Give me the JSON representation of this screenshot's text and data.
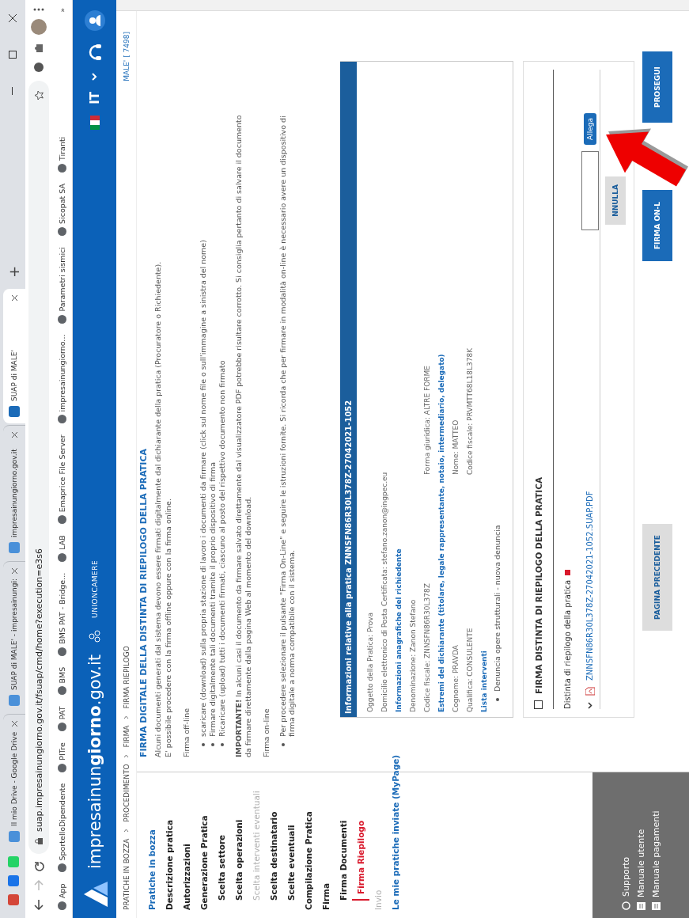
{
  "browser": {
    "tabs": [
      {
        "title": "Il mio Drive - Google Drive",
        "selected": false
      },
      {
        "title": "SUAP di MALE' - impresainungi:",
        "selected": false
      },
      {
        "title": "impresainungiorno.gov.it",
        "selected": false
      },
      {
        "title": "SUAP di MALE'",
        "selected": true
      }
    ],
    "new_tab": "+",
    "url": "suap.impresainungiorno.gov.it/fsuap/cmd/home?execution=e3s6",
    "bookmarks": [
      "App",
      "SportelloDipendente",
      "PITre",
      "PAT",
      "BMS",
      "BMS PAT - Bridge...",
      "LAB",
      "Emaprice File Server",
      "impresainungiorno...",
      "Parametri sismici",
      "Sicopat SA",
      "Tiranti"
    ],
    "more": "»"
  },
  "site": {
    "title": "impresainun**giorno**.gov.it",
    "partner": "UNIONCAMERE",
    "language": "IT"
  },
  "breadcrumb": [
    "PRATICHE IN BOZZA",
    "PROCEDIMENTO",
    "FIRMA",
    "FIRMA RIEPILOGO"
  ],
  "office": "MALE' [ 7498]",
  "sidebar": {
    "items": [
      {
        "label": "Pratiche in bozza",
        "kind": "link",
        "selected": false,
        "disabled": false
      },
      {
        "label": "Descrizione pratica",
        "kind": "step",
        "selected": false,
        "disabled": false
      },
      {
        "label": "Autorizzazioni",
        "kind": "step",
        "selected": false,
        "disabled": false
      },
      {
        "label": "Generazione Pratica",
        "kind": "step",
        "selected": false,
        "disabled": false,
        "children": [
          {
            "label": "Scelta settore",
            "kind": "step",
            "selected": false,
            "disabled": false
          },
          {
            "label": "Scelta operazioni",
            "kind": "step",
            "selected": false,
            "disabled": false
          },
          {
            "label": "Scelta interventi eventuali",
            "kind": "step",
            "selected": false,
            "disabled": true
          },
          {
            "label": "Scelta destinatario",
            "kind": "step",
            "selected": false,
            "disabled": false
          },
          {
            "label": "Scelte eventuali",
            "kind": "step",
            "selected": false,
            "disabled": false
          }
        ]
      },
      {
        "label": "Compilazione Pratica",
        "kind": "step",
        "selected": false,
        "disabled": false
      },
      {
        "label": "Firma",
        "kind": "step",
        "selected": false,
        "disabled": false,
        "children": [
          {
            "label": "Firma Documenti",
            "kind": "step",
            "selected": false,
            "disabled": false
          },
          {
            "label": "Firma Riepilogo",
            "kind": "step",
            "selected": true,
            "disabled": false
          }
        ]
      },
      {
        "label": "Invio",
        "kind": "step",
        "selected": false,
        "disabled": true
      },
      {
        "label": "Le mie pratiche inviate (MyPage)",
        "kind": "link",
        "selected": false,
        "disabled": false
      }
    ],
    "footer": [
      "Supporto",
      "Manuale utente",
      "Manuale pagamenti"
    ]
  },
  "main": {
    "title": "FIRMA DIGITALE DELLA DISTINTA DI RIEPILOGO DELLA PRATICA",
    "intro": [
      "Alcuni documenti generati dal sistema devono essere firmati digitalmente dal dichiarante della pratica (Procuratore o Richiedente).",
      "E' possibile procedere con la firma offline oppure con la firma online."
    ],
    "offline_heading": "Firma off-line",
    "offline_steps": [
      "scaricare (download) sulla propria stazione di lavoro i documenti da firmare (click sul nome file o sull'immagine a sinistra del nome)",
      "Firmare digitalmente tali documenti tramite il proprio dispositivo di firma",
      "Ricaricare (upload) tutti i documenti firmati, ciascuno al posto del rispettivo documento non firmato"
    ],
    "warning": "**IMPORTANTE!** In alcuni casi il documento da firmare salvato direttamente dal visualizzatore PDF potrebbe risultare corrotto. Si consiglia pertanto di salvare il documento da firmare direttamente dalla pagina Web al momento del download.",
    "online_heading": "Firma on-line",
    "online_steps": [
      "Per procedere selezionare il pulsante \"Firma On-Line\" e seguire le istruzioni fornite. Si ricorda che per firmare in modalità on-line è necessario avere un dispositivo di firma digitale a norma compatibile con il sistema."
    ]
  },
  "info": {
    "header": "Informazioni relative alla pratica ZNNSFN86R30L378Z-27042021-1052",
    "rows": [
      {
        "kind": "field",
        "left": "Oggetto della Pratica:  Prova"
      },
      {
        "kind": "field",
        "left": "Domicilio elettronico di Posta Certificata:  stefano.zanon@ingpec.eu"
      },
      {
        "kind": "heading",
        "left": "Informazioni anagrafiche del richiedente"
      },
      {
        "kind": "field",
        "left": "Denominazione:  Zanon Stefano"
      },
      {
        "kind": "field",
        "left": "Codice fiscale:  ZNNSFN86R30L378Z",
        "right": "Forma giuridica:  ALTRE FORME"
      },
      {
        "kind": "heading",
        "left": "Estremi del dichiarante (titolare, legale rappresentante, notaio, intermediario, delegato)"
      },
      {
        "kind": "field",
        "left": "Cognome:  PRAVDA",
        "right": "Nome:  MATTEO"
      },
      {
        "kind": "field",
        "left": "Qualifica:  CONSULENTE",
        "right": "Codice fiscale:  PRVMTT68L18L378K"
      },
      {
        "kind": "heading",
        "left": "Lista interventi"
      },
      {
        "kind": "bullet",
        "left": "Denuncia opere strutturali - nuova denuncia"
      }
    ]
  },
  "signature": {
    "checkbox": {
      "label": "FIRMA DISTINTA DI RIEPILOGO DELLA PRATICA",
      "checked": false
    },
    "document_label": "Distinta di riepilogo della pratica",
    "required": true,
    "file": "ZNNSFN86R30L378Z-27042021-1052.SUAP.PDF",
    "attach": "Allega",
    "cancel": "NNULLA"
  },
  "buttons": [
    {
      "label": "PAGINA PRECEDENTE",
      "kind": "secondary"
    },
    {
      "label": "FIRMA ON-L",
      "kind": "primary"
    },
    {
      "label": "PROSEGUI",
      "kind": "primary"
    }
  ]
}
